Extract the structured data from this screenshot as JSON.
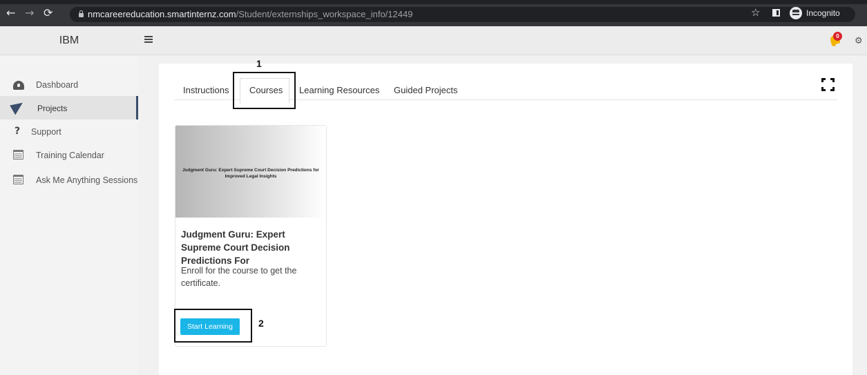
{
  "browser": {
    "url_host": "nmcareereducation.smartinternz.com",
    "url_path": "/Student/externships_workspace_info/12449",
    "incognito_label": "Incognito"
  },
  "header": {
    "brand": "IBM",
    "notification_count": "0"
  },
  "sidebar": {
    "items": [
      {
        "label": "Dashboard",
        "icon": "dashboard-icon"
      },
      {
        "label": "Projects",
        "icon": "paper-plane-icon",
        "active": true
      },
      {
        "label": "Support",
        "icon": "question-icon"
      },
      {
        "label": "Training Calendar",
        "icon": "calendar-icon"
      },
      {
        "label": "Ask Me Anything Sessions",
        "icon": "calendar-icon"
      }
    ]
  },
  "tabs": [
    {
      "label": "Instructions"
    },
    {
      "label": "Courses",
      "active": true
    },
    {
      "label": "Learning Resources"
    },
    {
      "label": "Guided Projects"
    }
  ],
  "course": {
    "thumbnail_text": "Judgment Guru: Expert Supreme Court Decision Predictions for Improved Legal Insights",
    "title": "Judgment Guru: Expert Supreme Court Decision Predictions For",
    "description": "Enroll for the course to get the certificate.",
    "button_label": "Start Learning"
  },
  "annotations": {
    "step1": "1",
    "step2": "2"
  },
  "colors": {
    "accent_button": "#1ab6e8",
    "active_border": "#3a4d6b",
    "badge": "#d9232d"
  }
}
